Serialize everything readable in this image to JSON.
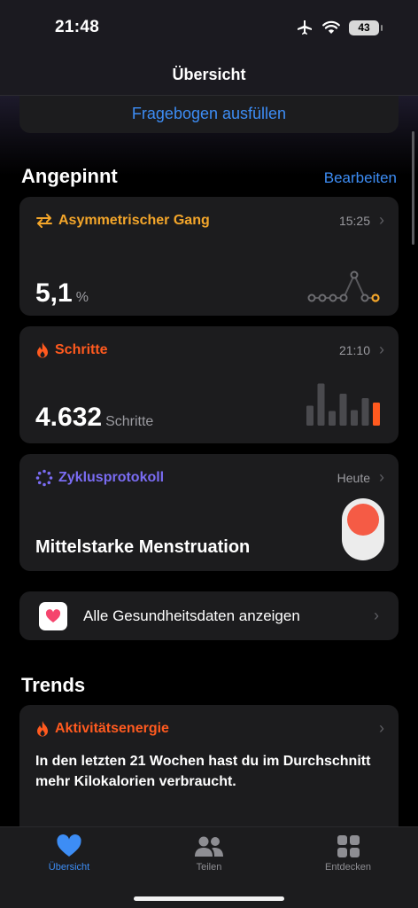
{
  "status": {
    "time": "21:48",
    "battery": "43"
  },
  "nav": {
    "title": "Übersicht"
  },
  "questionnaire": {
    "link": "Fragebogen ausfüllen"
  },
  "pinned": {
    "title": "Angepinnt",
    "edit_label": "Bearbeiten",
    "gait": {
      "label": "Asymmetrischer Gang",
      "time": "15:25",
      "value": "5,1",
      "unit": "%",
      "color": "#f4a62a"
    },
    "steps": {
      "label": "Schritte",
      "time": "21:10",
      "value": "4.632",
      "unit": "Schritte",
      "color": "#ff5a1f",
      "bars": [
        0.45,
        0.95,
        0.33,
        0.72,
        0.35,
        0.62,
        0.52
      ]
    },
    "cycle": {
      "label": "Zyklusprotokoll",
      "time": "Heute",
      "value": "Mittelstarke Menstruation",
      "color": "#7a6cf2",
      "dot_color": "#f55b45"
    }
  },
  "all_data": {
    "label": "Alle Gesundheitsdaten anzeigen"
  },
  "trends": {
    "title": "Trends",
    "energy": {
      "label": "Aktivitätsenergie",
      "text": "In den letzten 21 Wochen hast du im Durchschnitt mehr Kilokalorien verbraucht.",
      "color": "#ff5a1f"
    }
  },
  "tabs": [
    {
      "label": "Übersicht",
      "icon": "heart-icon",
      "active": true
    },
    {
      "label": "Teilen",
      "icon": "people-icon",
      "active": false
    },
    {
      "label": "Entdecken",
      "icon": "grid-icon",
      "active": false
    }
  ]
}
